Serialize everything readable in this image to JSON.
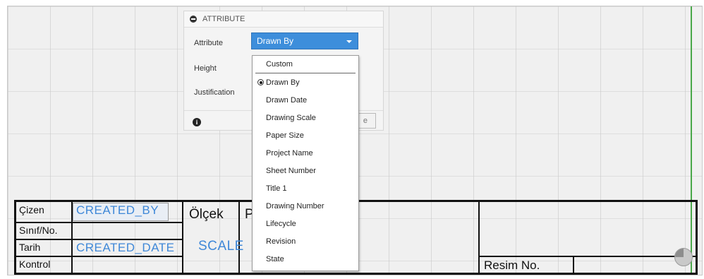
{
  "panel": {
    "header_title": "ATTRIBUTE",
    "labels": {
      "attribute": "Attribute",
      "height": "Height",
      "justification": "Justification"
    },
    "attribute_select_value": "Drawn By",
    "hidden_button_partial_label": "e",
    "icons": {
      "collapse": "collapse-circle-icon",
      "info": "info-icon",
      "caret": "chevron-down-icon"
    }
  },
  "dropdown": {
    "items": [
      "Custom",
      "Drawn By",
      "Drawn Date",
      "Drawing Scale",
      "Paper Size",
      "Project Name",
      "Sheet Number",
      "Title 1",
      "Drawing Number",
      "Lifecycle",
      "Revision",
      "State"
    ],
    "selected": "Drawn By"
  },
  "title_block": {
    "cizen": "Çizen",
    "sinif": "Sınıf/No.",
    "tarih": "Tarih",
    "kontrol": "Kontrol",
    "created_by": "CREATED_BY",
    "created_date": "CREATED_DATE",
    "olcek": "Ölçek",
    "scale": "SCALE",
    "partial_p": "P",
    "resim_no": "Resim No."
  },
  "colors": {
    "accent": "#3d8edb",
    "field_text": "#3f88d8",
    "guide_line": "#4aa84a"
  }
}
